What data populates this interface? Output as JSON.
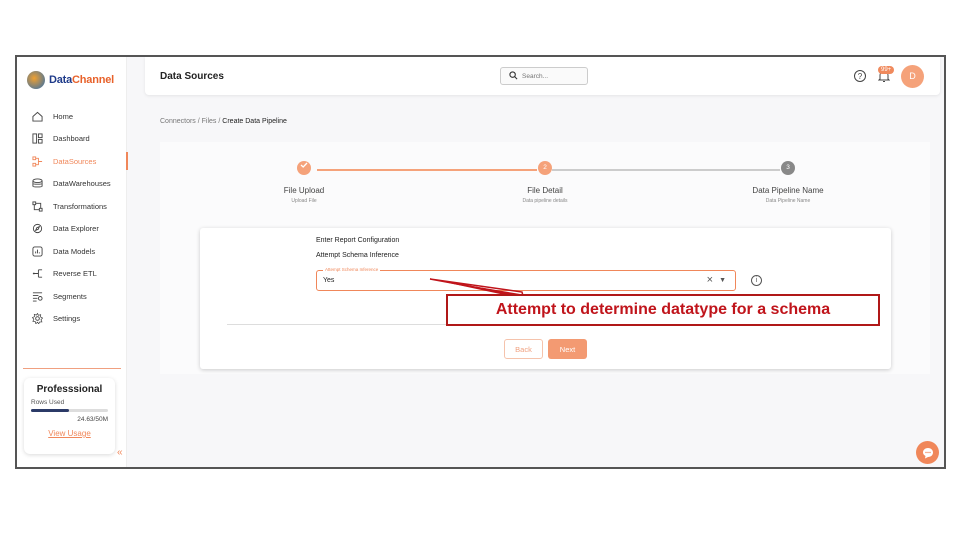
{
  "brand": {
    "name_part1": "Data",
    "name_part2": "Channel"
  },
  "header": {
    "title": "Data Sources",
    "search_placeholder": "Search...",
    "notification_badge": "99+",
    "avatar_initial": "D"
  },
  "sidebar": {
    "items": [
      {
        "label": "Home",
        "icon": "home-icon",
        "active": false
      },
      {
        "label": "Dashboard",
        "icon": "dashboard-icon",
        "active": false
      },
      {
        "label": "DataSources",
        "icon": "datasources-icon",
        "active": true
      },
      {
        "label": "DataWarehouses",
        "icon": "warehouse-icon",
        "active": false
      },
      {
        "label": "Transformations",
        "icon": "transformations-icon",
        "active": false
      },
      {
        "label": "Data Explorer",
        "icon": "explorer-icon",
        "active": false
      },
      {
        "label": "Data Models",
        "icon": "models-icon",
        "active": false
      },
      {
        "label": "Reverse ETL",
        "icon": "reverse-etl-icon",
        "active": false
      },
      {
        "label": "Segments",
        "icon": "segments-icon",
        "active": false
      },
      {
        "label": "Settings",
        "icon": "settings-icon",
        "active": false
      }
    ],
    "plan": {
      "title": "Professsional",
      "rows_label": "Rows Used",
      "rows_count": "24.63/50M",
      "usage_fraction": 0.49,
      "link": "View Usage"
    }
  },
  "breadcrumb": {
    "items": [
      "Connectors",
      "Files"
    ],
    "current": "Create Data Pipeline",
    "separator": "/"
  },
  "stepper": {
    "steps": [
      {
        "label": "File Upload",
        "sub": "Upload File",
        "state": "done",
        "number": ""
      },
      {
        "label": "File Detail",
        "sub": "Data pipeline details",
        "state": "active",
        "number": "2"
      },
      {
        "label": "Data Pipeline Name",
        "sub": "Data Pipeline Name",
        "state": "pending",
        "number": "3"
      }
    ]
  },
  "form": {
    "heading": "Enter Report Configuration",
    "subheading": "Attempt Schema Inference",
    "field_label": "Attempt Schema Inference",
    "field_value": "Yes",
    "back_label": "Back",
    "next_label": "Next"
  },
  "annotation": {
    "text": "Attempt to determine datatype for a schema"
  },
  "colors": {
    "accent": "#f0875a",
    "annotation": "#c0141b",
    "brand_blue": "#1f3b8a"
  }
}
